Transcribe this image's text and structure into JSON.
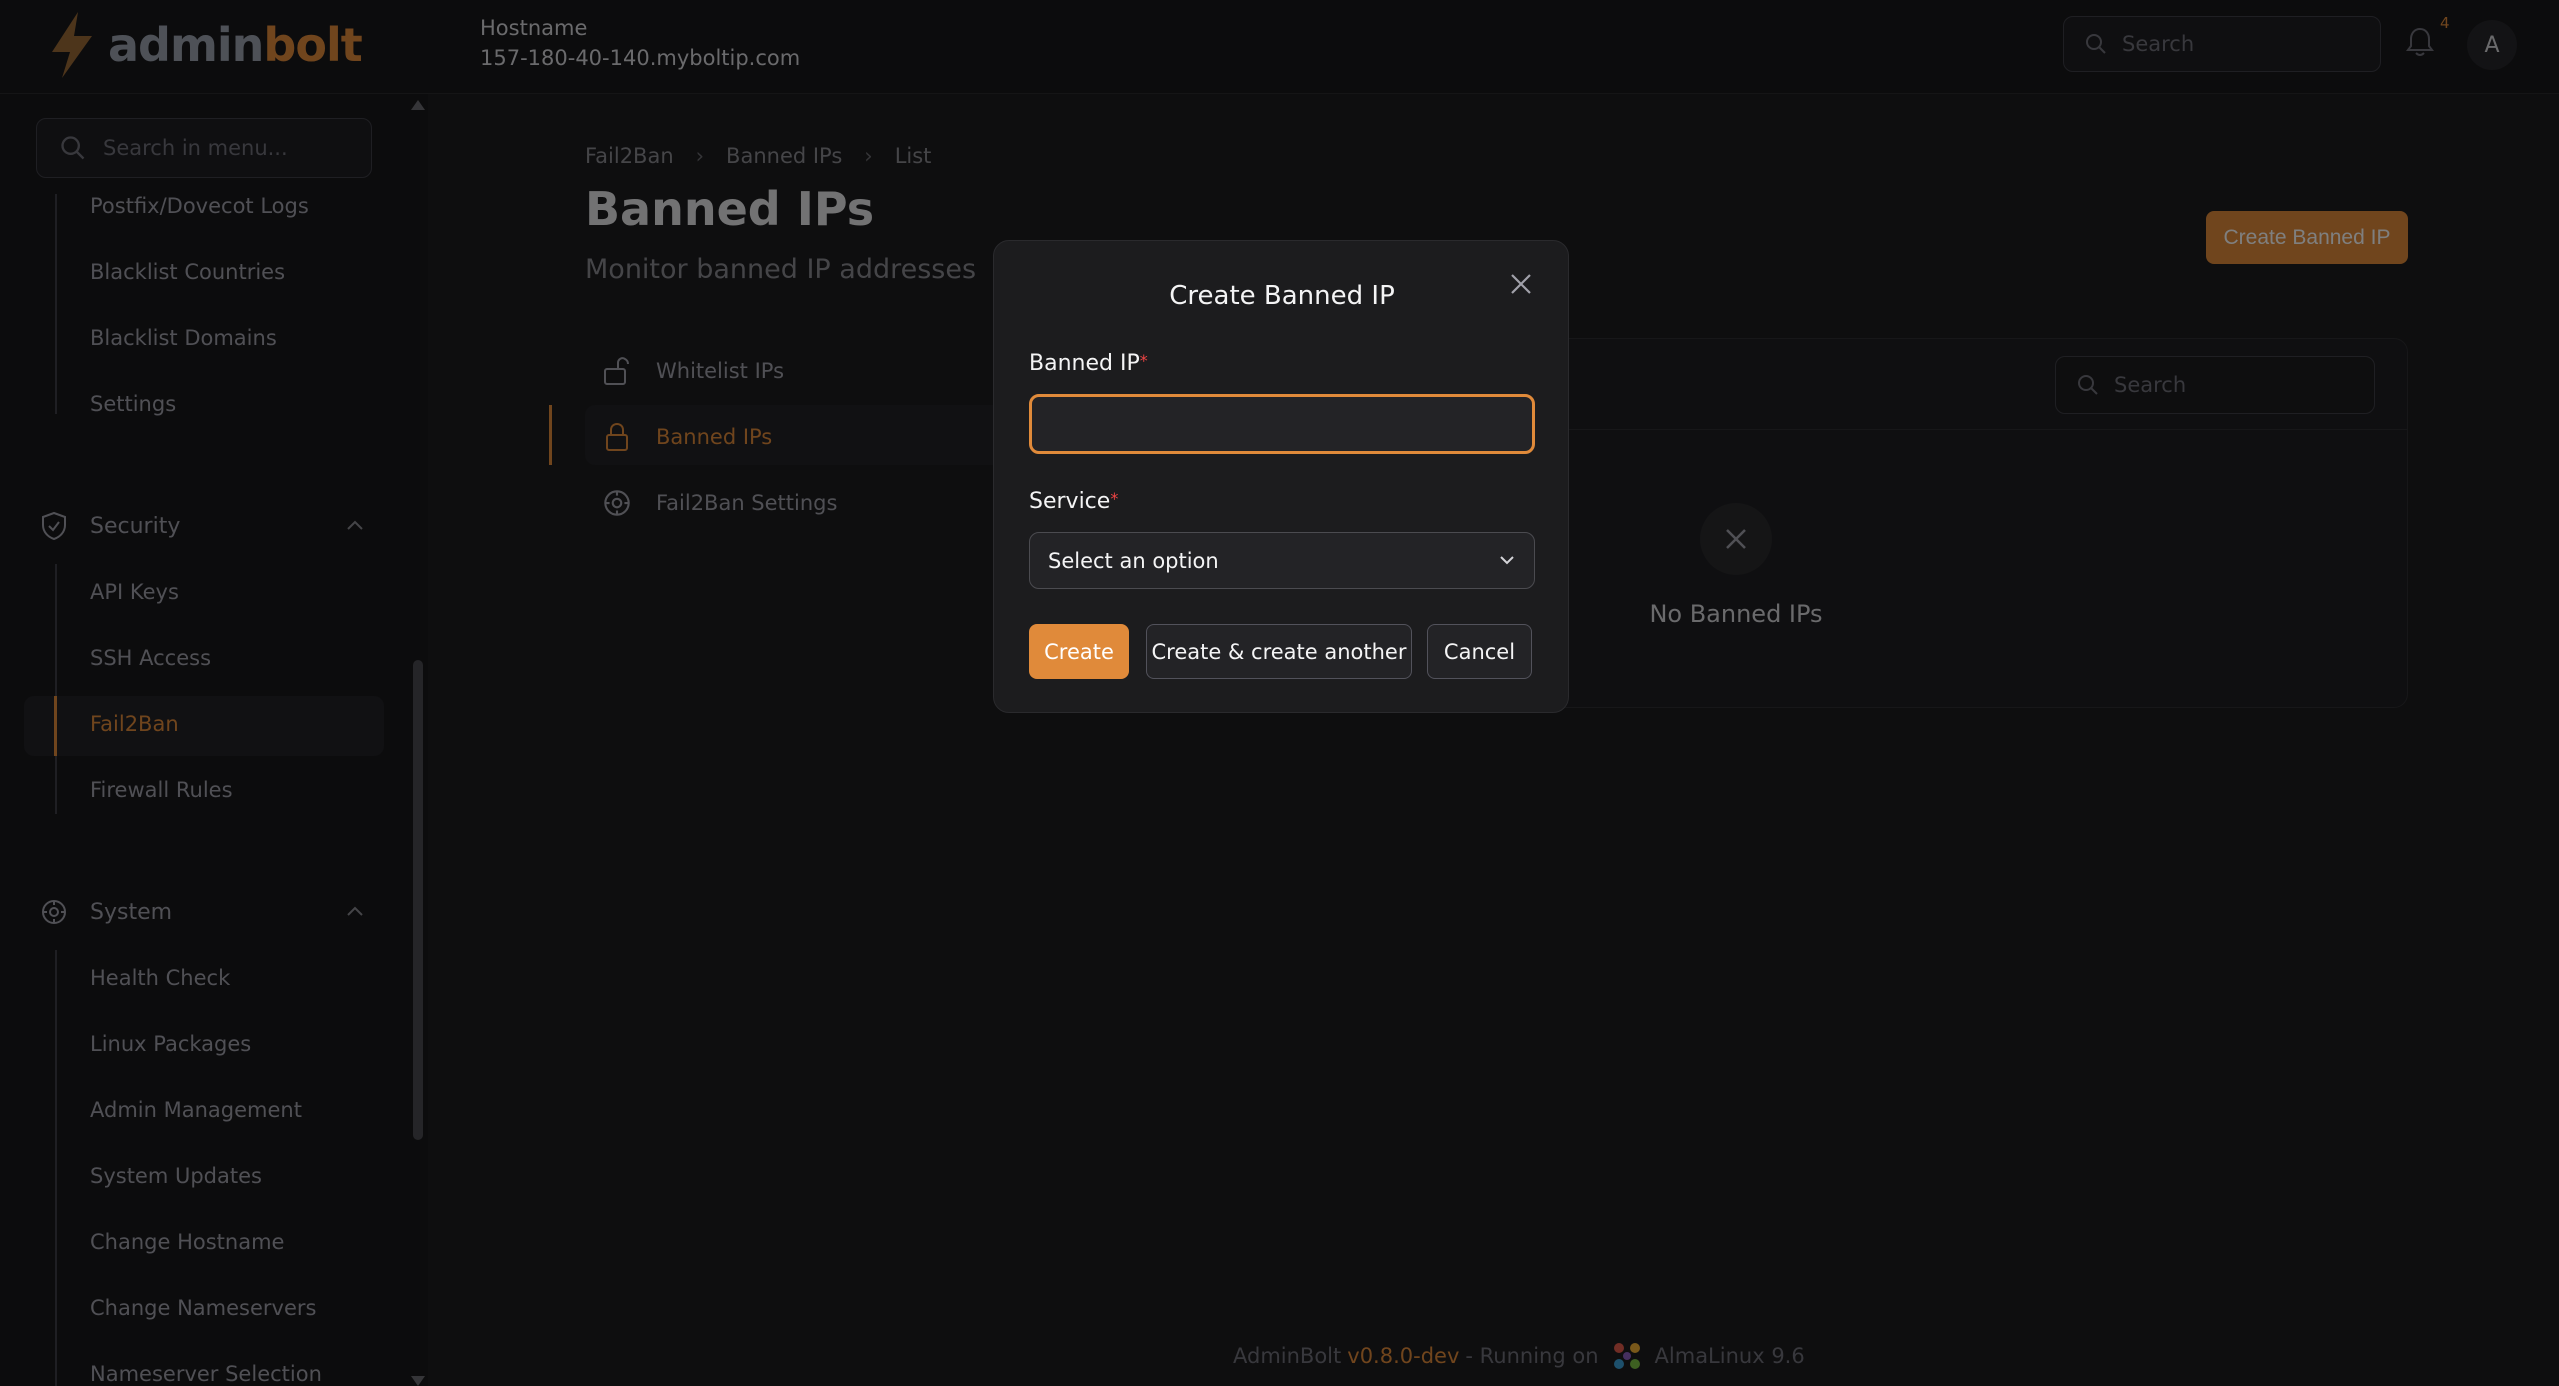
{
  "topbar": {
    "logo_prefix": "admin",
    "logo_suffix": "bolt",
    "hostname_label": "Hostname",
    "hostname_value": "157-180-40-140.myboltip.com",
    "search_placeholder": "Search",
    "notification_count": "4",
    "avatar_initial": "A"
  },
  "sidebar": {
    "search_placeholder": "Search in menu...",
    "items_top": [
      "Postfix/Dovecot Logs",
      "Blacklist Countries",
      "Blacklist Domains",
      "Settings"
    ],
    "security": {
      "label": "Security",
      "items": [
        "API Keys",
        "SSH Access",
        "Fail2Ban",
        "Firewall Rules"
      ]
    },
    "system": {
      "label": "System",
      "items": [
        "Health Check",
        "Linux Packages",
        "Admin Management",
        "System Updates",
        "Change Hostname",
        "Change Nameservers",
        "Nameserver Selection"
      ]
    }
  },
  "main": {
    "breadcrumb": [
      "Fail2Ban",
      "Banned IPs",
      "List"
    ],
    "title": "Banned IPs",
    "subtitle": "Monitor banned IP addresses",
    "create_button": "Create Banned IP",
    "subnav": [
      "Whitelist IPs",
      "Banned IPs",
      "Fail2Ban Settings"
    ],
    "table_search_placeholder": "Search",
    "empty_text": "No Banned IPs"
  },
  "footer": {
    "app": "AdminBolt",
    "version": "v0.8.0-dev",
    "running_on": "- Running on",
    "os": "AlmaLinux 9.6"
  },
  "modal": {
    "title": "Create Banned IP",
    "banned_ip_label": "Banned IP",
    "banned_ip_value": "",
    "service_label": "Service",
    "service_value": "Select an option",
    "required_mark": "*",
    "create": "Create",
    "create_another": "Create & create another",
    "cancel": "Cancel"
  },
  "colors": {
    "accent": "#e08a3a",
    "background": "#1c1c1e",
    "required": "#ef4444"
  }
}
